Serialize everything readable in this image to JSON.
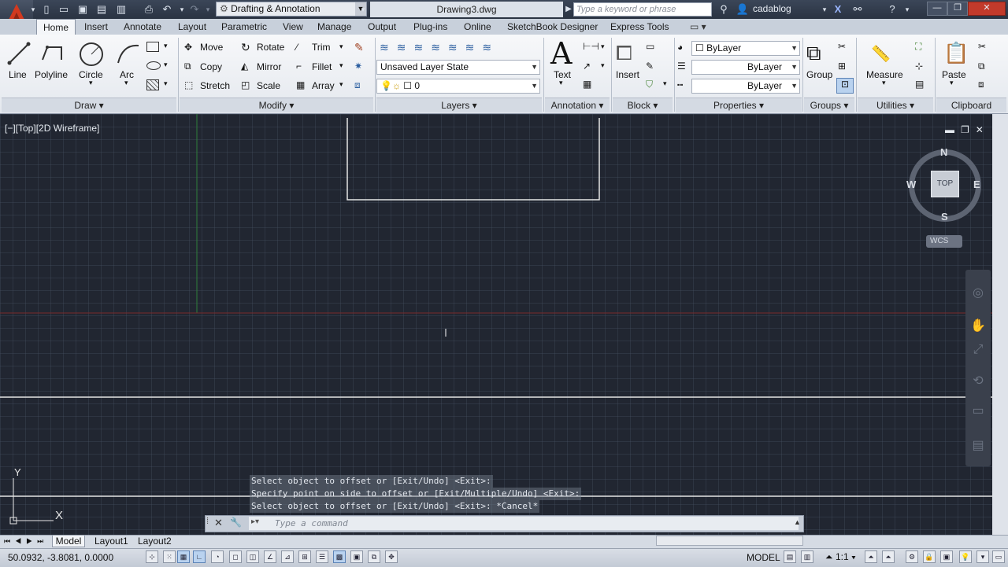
{
  "title_bar": {
    "workspace": "Drafting & Annotation",
    "document_title": "Drawing3.dwg",
    "search_placeholder": "Type a keyword or phrase",
    "user": "cadablog"
  },
  "ribbon_tabs": [
    "Home",
    "Insert",
    "Annotate",
    "Layout",
    "Parametric",
    "View",
    "Manage",
    "Output",
    "Plug-ins",
    "Online",
    "SketchBook Designer",
    "Express Tools"
  ],
  "active_tab": "Home",
  "panels": {
    "draw": {
      "title": "Draw",
      "tools": [
        "Line",
        "Polyline",
        "Circle",
        "Arc"
      ]
    },
    "modify": {
      "title": "Modify",
      "tools": [
        "Move",
        "Rotate",
        "Trim",
        "Copy",
        "Mirror",
        "Fillet",
        "Stretch",
        "Scale",
        "Array"
      ]
    },
    "layers": {
      "title": "Layers",
      "layer_state": "Unsaved Layer State",
      "current_layer": "0"
    },
    "annotation": {
      "title": "Annotation",
      "tool": "Text"
    },
    "block": {
      "title": "Block",
      "tool": "Insert"
    },
    "properties": {
      "title": "Properties",
      "color": "ByLayer",
      "linetype": "ByLayer",
      "lineweight": "ByLayer"
    },
    "groups": {
      "title": "Groups",
      "tool": "Group"
    },
    "utilities": {
      "title": "Utilities",
      "tool": "Measure"
    },
    "clipboard": {
      "title": "Clipboard",
      "tool": "Paste"
    }
  },
  "viewport": {
    "label": "[−][Top][2D Wireframe]",
    "compass": {
      "n": "N",
      "s": "S",
      "e": "E",
      "w": "W"
    },
    "cube_face": "TOP",
    "ucs_label": "WCS",
    "ucs_axes": {
      "x": "X",
      "y": "Y"
    }
  },
  "command_history": [
    "Select object to offset or [Exit/Undo] <Exit>:",
    "Specify point on side to offset or [Exit/Multiple/Undo] <Exit>:",
    "Select object to offset or [Exit/Undo] <Exit>: *Cancel*"
  ],
  "command_placeholder": "Type a command",
  "layout_tabs": [
    "Model",
    "Layout1",
    "Layout2"
  ],
  "status": {
    "coordinates": "50.0932, -3.8081, 0.0000",
    "model_label": "MODEL",
    "scale": "1:1"
  },
  "colors": {
    "canvas_bg": "#212631",
    "accent_red": "#c8371c",
    "ribbon_bg": "#eef1f5"
  }
}
